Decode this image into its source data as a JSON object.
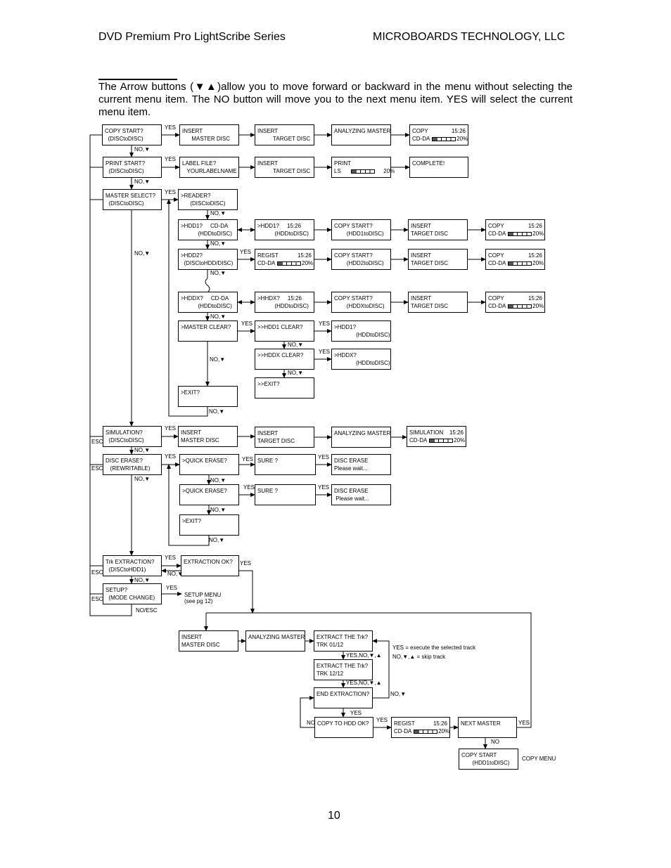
{
  "header": {
    "left": "DVD Premium Pro LightScribe Series",
    "right": "MICROBOARDS TECHNOLOGY, LLC"
  },
  "intro": "The Arrow buttons (▼▲)allow you to move forward or backward in the menu without selecting the current menu item.  The NO button will move you to the next menu item.  YES will select the current menu item.",
  "page_number": "10",
  "progress": {
    "value_percent": 20,
    "label": "20%",
    "time": "15:26"
  },
  "boxes": {
    "copy_start": [
      "COPY START?",
      "  (DISCtoDISC)"
    ],
    "cs_insert_master": [
      "INSERT",
      "      MASTER DISC"
    ],
    "cs_insert_target": [
      "INSERT",
      "          TARGET DISC"
    ],
    "cs_analyzing": [
      "ANALYZING MASTER",
      ""
    ],
    "cs_copy": [
      "COPY",
      "CD-DA"
    ],
    "print_start": [
      "PRINT START?",
      "  (DISCtoDISC)"
    ],
    "ps_label_file": [
      "LABEL FILE?",
      "   YOURLABELNAME"
    ],
    "ps_insert_target": [
      "INSERT",
      "          TARGET DISC"
    ],
    "ps_print": [
      "PRINT",
      "LS"
    ],
    "ps_complete": [
      "COMPLETE!",
      ""
    ],
    "master_select": [
      "MASTER SELECT?",
      "  (DISCtoDISC)"
    ],
    "reader": [
      ">READER?",
      "      (DISCtoDISC)"
    ],
    "hdd1": [
      ">HDD1?     CD-DA",
      "           (HDDtoDISC)"
    ],
    "hdd1_time": [
      ">HDD1?     15:26",
      "           (HDDtoDISC)"
    ],
    "hdd1_copy_start": [
      "COPY START?",
      "        (HDD1toDISC)"
    ],
    "hdd1_insert": [
      "INSERT",
      "TARGET DISC"
    ],
    "hdd1_copy": [
      "COPY",
      "CD-DA"
    ],
    "hdd2": [
      ">HDD2?",
      "  (DISCtoHDD/DISC)"
    ],
    "hdd2_regist": [
      "REGIST",
      "CD-DA"
    ],
    "hdd2_copy_start": [
      "COPY START?",
      "        (HDD2toDISC)"
    ],
    "hdd2_insert": [
      "INSERT",
      "TARGET DISC"
    ],
    "hdd2_copy": [
      "COPY",
      "CD-DA"
    ],
    "hddx": [
      ">HDDX?     CD-DA",
      "           (HDDtoDISC)"
    ],
    "hhdx_time": [
      ">HHDX?     15:26",
      "           (HDDtoDISC)"
    ],
    "hddx_copy_start": [
      "COPY START?",
      "        (HDDXtoDISC)"
    ],
    "hddx_insert": [
      "INSERT",
      "TARGET DISC"
    ],
    "hddx_copy": [
      "COPY",
      "CD-DA"
    ],
    "master_clear": [
      ">MASTER CLEAR?",
      ""
    ],
    "hdd1_clear": [
      ">>HDD1 CLEAR?",
      ""
    ],
    "hdd1_result": [
      ">HDD1?",
      "              (HDDtoDISC)"
    ],
    "hddx_clear": [
      ">>HDDX CLEAR?",
      ""
    ],
    "hddx_result": [
      ">HDDX?",
      "              (HDDtoDISC)"
    ],
    "sub_exit": [
      ">>EXIT?",
      ""
    ],
    "ms_exit": [
      ">EXIT?",
      ""
    ],
    "simulation": [
      "SIMULATION?",
      "  (DISCtoDISC)"
    ],
    "sim_insert_master": [
      "INSERT",
      "MASTER DISC"
    ],
    "sim_insert_target": [
      "INSERT",
      "TARGET DISC"
    ],
    "sim_analyzing": [
      "ANALYZING MASTER",
      ""
    ],
    "sim_result": [
      "SIMULATION",
      "CD-DA"
    ],
    "disc_erase": [
      "DISC ERASE?",
      "   (REWRITABLE)"
    ],
    "quick_erase_1": [
      ">QUICK ERASE?",
      ""
    ],
    "sure_1": [
      "SURE ?",
      ""
    ],
    "erase_wait_1": [
      "DISC ERASE",
      "Please wait..."
    ],
    "quick_erase_2": [
      ">QUICK ERASE?",
      ""
    ],
    "sure_2": [
      "SURE ?",
      ""
    ],
    "erase_wait_2": [
      "DISC ERASE",
      " Please wait..."
    ],
    "erase_exit": [
      ">EXIT?",
      ""
    ],
    "trk_extraction": [
      "Trk EXTRACTION?",
      "  (DISCtoHDD1)"
    ],
    "extraction_ok": [
      "EXTRACTION OK?",
      ""
    ],
    "setup": [
      "SETUP?",
      "  (MODE CHANGE)"
    ],
    "ex_insert_master": [
      "INSERT",
      "MASTER DISC"
    ],
    "ex_analyzing": [
      "ANALYZING MASTER",
      ""
    ],
    "extract_01": [
      "EXTRACT THE Trk?",
      "TRK 01/12"
    ],
    "extract_12": [
      "EXTRACT THE Trk?",
      "TRK 12/12"
    ],
    "end_extraction": [
      "END EXTRACTION?",
      ""
    ],
    "copy_to_hdd": [
      "COPY TO HDD OK?",
      ""
    ],
    "ex_regist": [
      "REGIST",
      "CD-DA"
    ],
    "next_master": [
      "NEXT MASTER",
      ""
    ],
    "copy_start_hdd1": [
      "COPY START",
      "       (HDD1toDISC)"
    ]
  },
  "labels": {
    "yes": "YES",
    "no_down": "NO,▼",
    "no": "NO",
    "esc": "ESC",
    "no_esc": "NO/ESC",
    "yes_no_arrows": "YES,NO,▼,▲",
    "setup_menu": "SETUP MENU",
    "setup_menu_ref": "(see pg 12)",
    "legend_yes": "YES = execute the selected track",
    "legend_no": "NO,▼,▲ = skip track",
    "copy_menu": "COPY  MENU"
  }
}
